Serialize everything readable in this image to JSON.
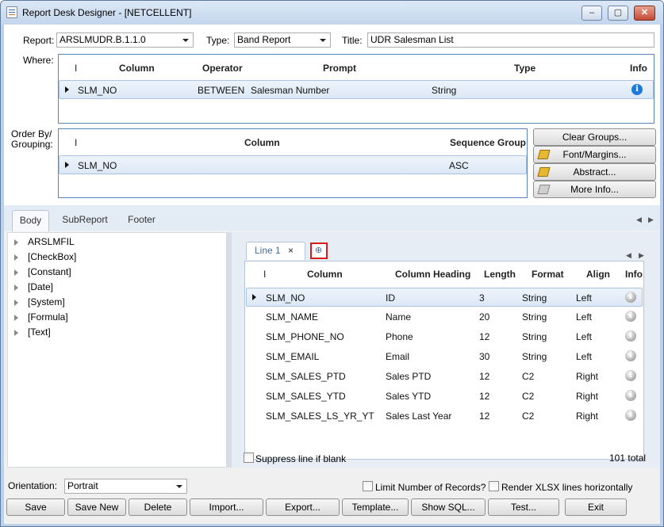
{
  "window": {
    "title": "Report Desk Designer - [NETCELLENT]"
  },
  "header": {
    "report_label": "Report:",
    "report_value": "ARSLMUDR.B.1.1.0",
    "type_label": "Type:",
    "type_value": "Band Report",
    "title_label": "Title:",
    "title_value": "UDR Salesman List"
  },
  "where": {
    "label": "Where:",
    "columns": [
      "Column",
      "Operator",
      "Prompt",
      "Type",
      "Info"
    ],
    "rows": [
      {
        "column": "SLM_NO",
        "operator": "BETWEEN",
        "prompt": "Salesman Number",
        "type": "String"
      }
    ]
  },
  "order": {
    "label_line1": "Order By/",
    "label_line2": "Grouping:",
    "columns": [
      "Column",
      "Sequence",
      "Group"
    ],
    "rows": [
      {
        "column": "SLM_NO",
        "sequence": "ASC"
      }
    ]
  },
  "side_buttons": [
    "Clear Groups...",
    "Font/Margins...",
    "Abstract...",
    "More Info..."
  ],
  "tabs": [
    "Body",
    "SubReport",
    "Footer"
  ],
  "tree": [
    "ARSLMFIL",
    "[CheckBox]",
    "[Constant]",
    "[Date]",
    "[System]",
    "[Formula]",
    "[Text]"
  ],
  "line_tab": {
    "label": "Line 1",
    "close": "×"
  },
  "line_grid": {
    "columns": [
      "Column",
      "Column Heading",
      "Length",
      "Format",
      "Align",
      "Info"
    ],
    "rows": [
      {
        "column": "SLM_NO",
        "heading": "ID",
        "length": "3",
        "format": "String",
        "align": "Left"
      },
      {
        "column": "SLM_NAME",
        "heading": "Name",
        "length": "20",
        "format": "String",
        "align": "Left"
      },
      {
        "column": "SLM_PHONE_NO",
        "heading": "Phone",
        "length": "12",
        "format": "String",
        "align": "Left"
      },
      {
        "column": "SLM_EMAIL",
        "heading": "Email",
        "length": "30",
        "format": "String",
        "align": "Left"
      },
      {
        "column": "SLM_SALES_PTD",
        "heading": "Sales PTD",
        "length": "12",
        "format": "C2",
        "align": "Right"
      },
      {
        "column": "SLM_SALES_YTD",
        "heading": "Sales YTD",
        "length": "12",
        "format": "C2",
        "align": "Right"
      },
      {
        "column": "SLM_SALES_LS_YR_YT",
        "heading": "Sales Last Year",
        "length": "12",
        "format": "C2",
        "align": "Right"
      }
    ]
  },
  "suppress_label": "Suppress line if blank",
  "total_label": "101 total",
  "orientation": {
    "label": "Orientation:",
    "value": "Portrait"
  },
  "limit_label": "Limit Number of Records?",
  "render_label": "Render XLSX lines horizontally",
  "bottom_buttons": [
    "Save",
    "Save New",
    "Delete",
    "Import...",
    "Export...",
    "Template...",
    "Show SQL...",
    "Test...",
    "Exit"
  ],
  "info_glyph": "i",
  "colors": {
    "accent": "#5c86b8",
    "highlight": "#d81c1c"
  }
}
